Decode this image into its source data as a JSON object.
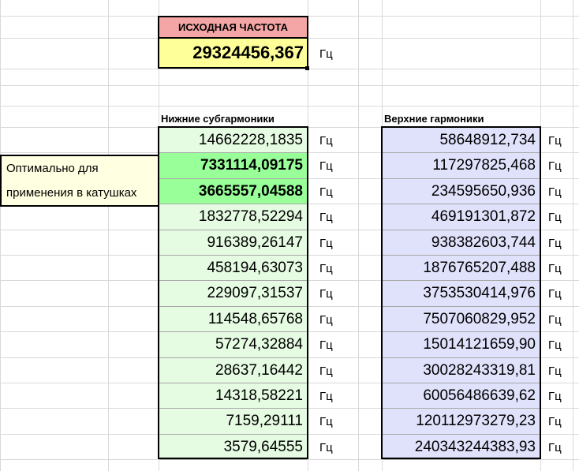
{
  "source": {
    "title": "ИСХОДНАЯ ЧАСТОТА",
    "value": "29324456,367",
    "unit": "Гц"
  },
  "lower": {
    "header": "Нижние субгармоники",
    "unit": "Гц",
    "rows": [
      {
        "value": "14662228,1835",
        "optimal": false
      },
      {
        "value": "7331114,09175",
        "optimal": true
      },
      {
        "value": "3665557,04588",
        "optimal": true
      },
      {
        "value": "1832778,52294",
        "optimal": false
      },
      {
        "value": "916389,26147",
        "optimal": false
      },
      {
        "value": "458194,63073",
        "optimal": false
      },
      {
        "value": "229097,31537",
        "optimal": false
      },
      {
        "value": "114548,65768",
        "optimal": false
      },
      {
        "value": "57274,32884",
        "optimal": false
      },
      {
        "value": "28637,16442",
        "optimal": false
      },
      {
        "value": "14318,58221",
        "optimal": false
      },
      {
        "value": "7159,29111",
        "optimal": false
      },
      {
        "value": "3579,64555",
        "optimal": false
      }
    ]
  },
  "upper": {
    "header": "Верхние гармоники",
    "unit": "Гц",
    "rows": [
      "58648912,734",
      "117297825,468",
      "234595650,936",
      "469191301,872",
      "938382603,744",
      "1876765207,488",
      "3753530414,976",
      "7507060829,952",
      "15014121659,90",
      "30028243319,81",
      "60056486639,62",
      "120112973279,23",
      "240343244383,93"
    ]
  },
  "note": {
    "line1": "Оптимально для",
    "line2": "применения в катушках"
  },
  "colors": {
    "source_title_bg": "#f4a6a6",
    "source_value_bg": "#ffff99",
    "lower_bg": "#e5fbe2",
    "optimal_bg": "#99ff99",
    "upper_bg": "#e0e1fb",
    "note_bg": "#ffffe1"
  }
}
